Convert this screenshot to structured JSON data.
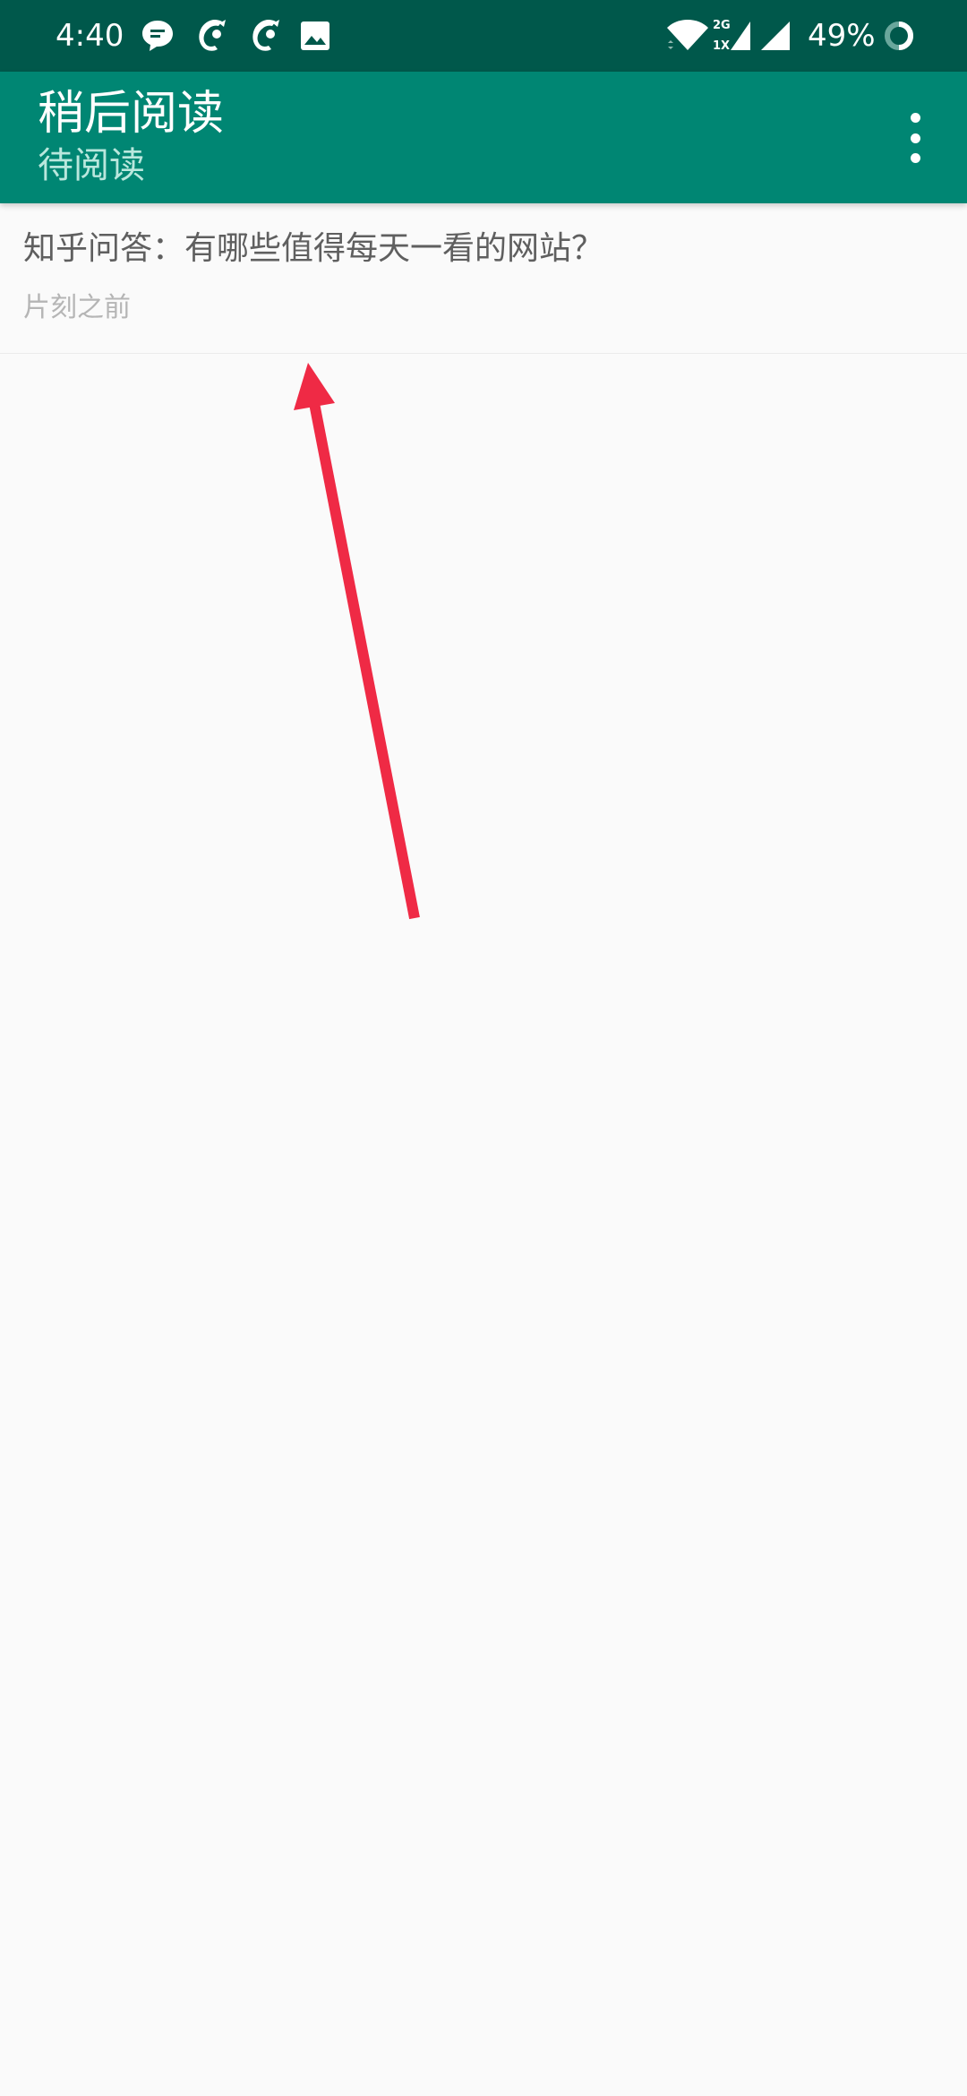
{
  "status_bar": {
    "time": "4:40",
    "battery_percent": "49%",
    "network_label_top": "2G",
    "network_label_bottom": "1X",
    "notification_icons": [
      "chat-bubble-icon",
      "dolphin-app-icon",
      "dolphin-app-icon",
      "image-icon"
    ],
    "system_icons": [
      "wifi-icon",
      "cell-signal-icon",
      "cell-signal-icon",
      "battery-ring-icon"
    ]
  },
  "app_bar": {
    "title": "稍后阅读",
    "subtitle": "待阅读",
    "overflow_icon": "more-vert-icon"
  },
  "list": {
    "items": [
      {
        "title": "知乎问答：有哪些值得每天一看的网站？",
        "time": "片刻之前"
      }
    ]
  },
  "colors": {
    "status_bar": "#00584b",
    "app_bar": "#008673",
    "subtitle": "#b9e7dd",
    "background": "#fafafa",
    "annotation_arrow": "#ef2a45"
  }
}
